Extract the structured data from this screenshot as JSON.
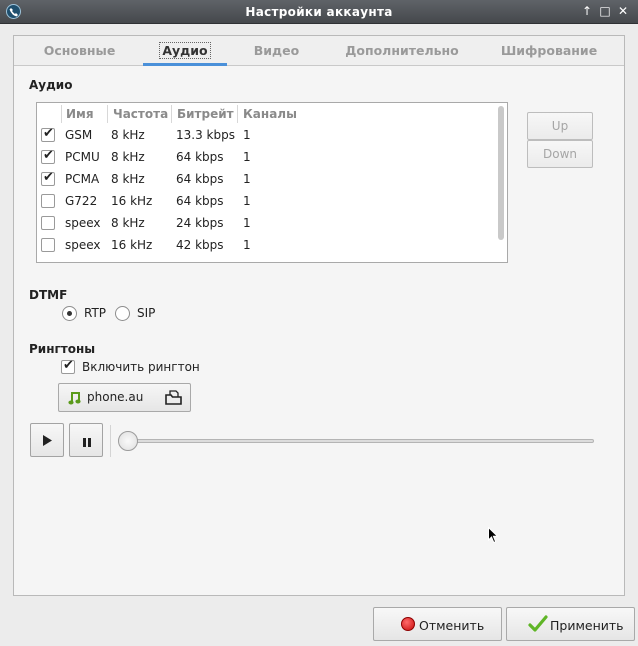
{
  "window": {
    "title": "Настройки аккаунта"
  },
  "tabs": [
    {
      "label": "Основные"
    },
    {
      "label": "Аудио"
    },
    {
      "label": "Видео"
    },
    {
      "label": "Дополнительно"
    },
    {
      "label": "Шифрование"
    }
  ],
  "audio": {
    "section_label": "Аудио",
    "headers": [
      "Имя",
      "Частота",
      "Битрейт",
      "Каналы"
    ],
    "codecs": [
      {
        "enabled": true,
        "name": "GSM",
        "frequency": "8 kHz",
        "bitrate": "13.3 kbps",
        "channels": "1"
      },
      {
        "enabled": true,
        "name": "PCMU",
        "frequency": "8 kHz",
        "bitrate": "64 kbps",
        "channels": "1"
      },
      {
        "enabled": true,
        "name": "PCMA",
        "frequency": "8 kHz",
        "bitrate": "64 kbps",
        "channels": "1"
      },
      {
        "enabled": false,
        "name": "G722",
        "frequency": "16 kHz",
        "bitrate": "64 kbps",
        "channels": "1"
      },
      {
        "enabled": false,
        "name": "speex",
        "frequency": "8 kHz",
        "bitrate": "24 kbps",
        "channels": "1"
      },
      {
        "enabled": false,
        "name": "speex",
        "frequency": "16 kHz",
        "bitrate": "42 kbps",
        "channels": "1"
      }
    ],
    "up_label": "Up",
    "down_label": "Down"
  },
  "dtmf": {
    "section_label": "DTMF",
    "options": [
      "RTP",
      "SIP"
    ],
    "selected": "RTP"
  },
  "ringtones": {
    "section_label": "Рингтоны",
    "enable_label": "Включить рингтон",
    "enabled": true,
    "file_name": "phone.au",
    "playback_position": 0
  },
  "footer": {
    "cancel_label": "Отменить",
    "apply_label": "Применить"
  },
  "colors": {
    "tab_accent": "#4a90d9",
    "cancel_icon": "#d81e1e",
    "apply_icon": "#5fb526",
    "music_icon": "#5a9a1a"
  }
}
